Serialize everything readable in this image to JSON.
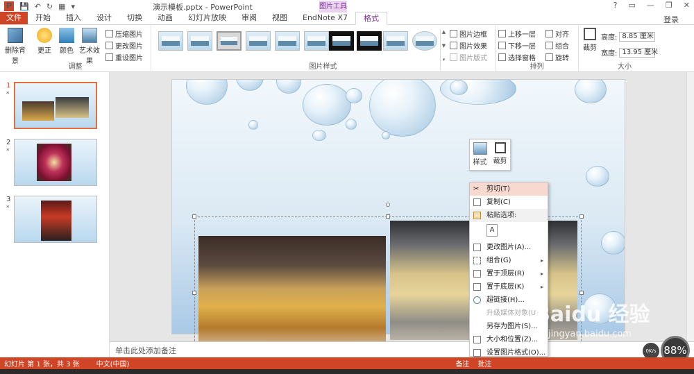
{
  "window": {
    "title": "演示模板.pptx - PowerPoint",
    "tool_tab_head": "图片工具",
    "app_logo": "P",
    "login": "登录",
    "win_buttons": [
      "?",
      "▭",
      "—",
      "❐",
      "✕"
    ]
  },
  "quick_access": [
    "💾",
    "↶",
    "↻",
    "▦",
    "▾"
  ],
  "tabs": [
    "文件",
    "开始",
    "插入",
    "设计",
    "切换",
    "动画",
    "幻灯片放映",
    "审阅",
    "视图",
    "EndNote X7",
    "格式"
  ],
  "ribbon": {
    "adjust": {
      "label": "调整",
      "remove_bg": "删除背景",
      "correct": "更正",
      "color": "颜色",
      "art": "艺术效果",
      "compress": "压缩图片",
      "change": "更改图片",
      "reset": "重设图片"
    },
    "styles": {
      "label": "图片样式",
      "border": "图片边框",
      "effect": "图片效果",
      "layout": "图片版式",
      "arrows": [
        "▲",
        "▼",
        "▾"
      ]
    },
    "arrange": {
      "label": "排列",
      "forward": "上移一层",
      "backward": "下移一层",
      "select_pane": "选择窗格",
      "align": "对齐",
      "group": "组合",
      "rotate": "旋转"
    },
    "size": {
      "label": "大小",
      "crop": "裁剪",
      "height_label": "高度:",
      "height_value": "8.85 厘米",
      "width_label": "宽度:",
      "width_value": "13.95 厘米"
    }
  },
  "thumbnails": [
    {
      "num": "1",
      "star": "*"
    },
    {
      "num": "2",
      "star": "*"
    },
    {
      "num": "3",
      "star": "*"
    }
  ],
  "notes_placeholder": "单击此处添加备注",
  "mini_toolbar": {
    "style": "样式",
    "crop": "裁剪"
  },
  "context_menu": {
    "cut": "剪切(T)",
    "copy": "复制(C)",
    "paste_options": "粘贴选项:",
    "paste_icon": "A",
    "change_picture": "更改图片(A)...",
    "group": "组合(G)",
    "bring_front": "置于顶层(R)",
    "send_back": "置于底层(K)",
    "hyperlink": "超链接(H)...",
    "upgrade_media": "升级媒体对象(U)",
    "save_as_picture": "另存为图片(S)...",
    "size_position": "大小和位置(Z)...",
    "format_picture": "设置图片格式(O)...",
    "submenu_arrow": "▸"
  },
  "status": {
    "slide_info": "幻灯片 第 1 张，共 3 张",
    "language": "中文(中国)",
    "notes": "备注",
    "comments": "批注"
  },
  "watermark": {
    "brand": "Baidu 经验",
    "url": "jingyan.baidu.com"
  },
  "gauge": {
    "percent": "88%",
    "speed": "0K/s"
  },
  "colors": {
    "accent": "#d04526",
    "format_tab": "#7a3490"
  }
}
